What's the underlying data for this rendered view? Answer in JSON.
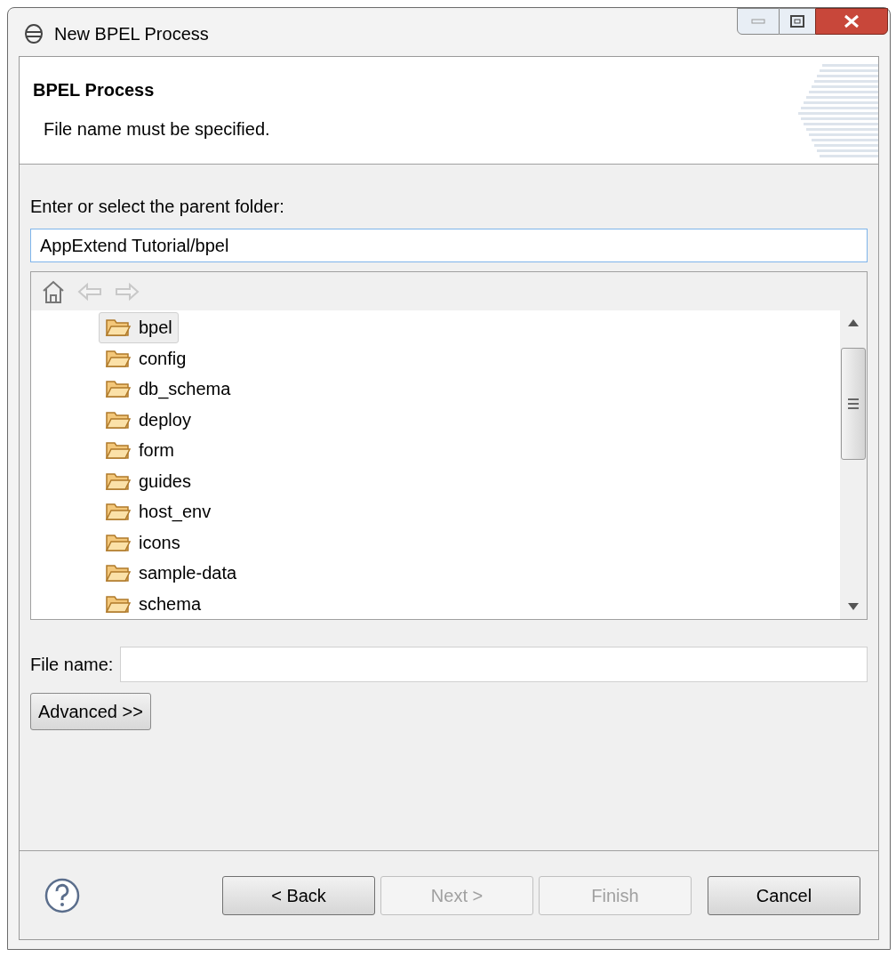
{
  "window": {
    "title": "New BPEL Process"
  },
  "header": {
    "title": "BPEL Process",
    "message": "File name must be specified."
  },
  "folder": {
    "label": "Enter or select the parent folder:",
    "value": "AppExtend Tutorial/bpel"
  },
  "tree": {
    "toolbar": [
      {
        "kind": "home",
        "disabled": false
      },
      {
        "kind": "back",
        "disabled": true
      },
      {
        "kind": "forward",
        "disabled": true
      }
    ],
    "items": [
      {
        "label": "bpel",
        "selected": true
      },
      {
        "label": "config",
        "selected": false
      },
      {
        "label": "db_schema",
        "selected": false
      },
      {
        "label": "deploy",
        "selected": false
      },
      {
        "label": "form",
        "selected": false
      },
      {
        "label": "guides",
        "selected": false
      },
      {
        "label": "host_env",
        "selected": false
      },
      {
        "label": "icons",
        "selected": false
      },
      {
        "label": "sample-data",
        "selected": false
      },
      {
        "label": "schema",
        "selected": false
      }
    ]
  },
  "file_name": {
    "label": "File name:"
  },
  "advanced_button": "Advanced >>",
  "buttons": [
    {
      "label": "< Back",
      "disabled": false
    },
    {
      "label": "Next >",
      "disabled": true
    },
    {
      "label": "Finish",
      "disabled": true
    },
    {
      "label": "Cancel",
      "disabled": false
    }
  ]
}
